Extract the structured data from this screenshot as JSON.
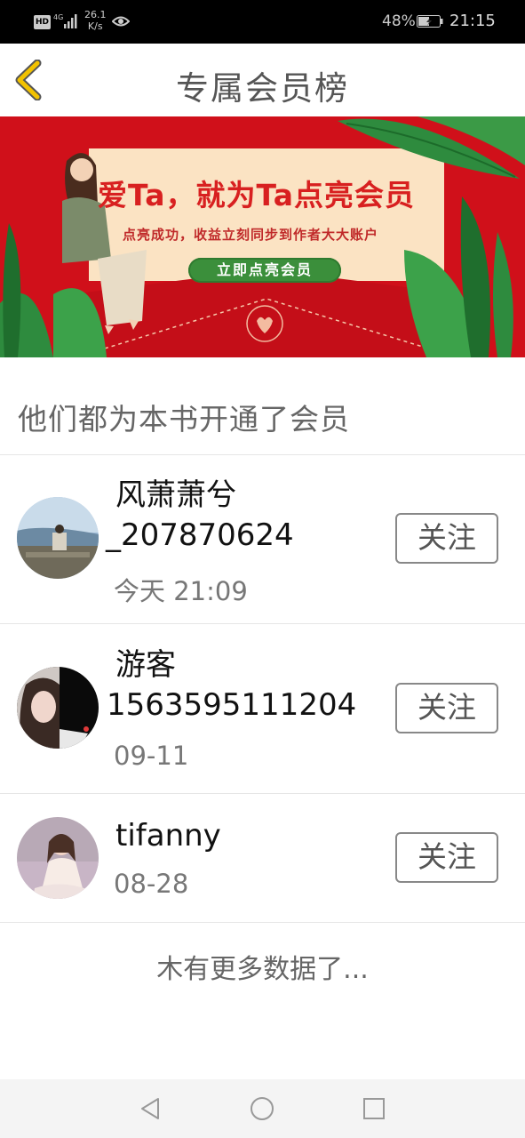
{
  "status_bar": {
    "hd": "HD",
    "network_type": "4G",
    "net_speed_value": "26.1",
    "net_speed_unit": "K/s",
    "battery_percent": "48%",
    "time": "21:15",
    "icons": [
      "hd-icon",
      "signal-icon",
      "eye-icon",
      "battery-icon"
    ]
  },
  "header": {
    "title": "专属会员榜",
    "back_icon": "chevron-left-icon",
    "accent": "#f2c200"
  },
  "banner": {
    "headline": "爱Ta，就为Ta点亮会员",
    "subline": "点亮成功，收益立刻同步到作者大大账户",
    "cta_label": "立即点亮会员",
    "colors": {
      "background": "#d0101a",
      "card": "#fbe3c3",
      "cta": "#3b8f3b"
    }
  },
  "section": {
    "title": "他们都为本书开通了会员"
  },
  "members": [
    {
      "name_line1": "风萧萧兮",
      "name_line2": "_207870624",
      "date": "今天 21:09",
      "follow_label": "关注"
    },
    {
      "name_line1": "游客",
      "name_line2": "1563595111204",
      "date": "09-11",
      "follow_label": "关注"
    },
    {
      "name_line1": "tifanny",
      "date": "08-28",
      "follow_label": "关注"
    }
  ],
  "footer": {
    "no_more_text": "木有更多数据了..."
  },
  "nav_bar": {
    "icons": [
      "back-triangle-icon",
      "home-circle-icon",
      "recents-square-icon"
    ]
  }
}
